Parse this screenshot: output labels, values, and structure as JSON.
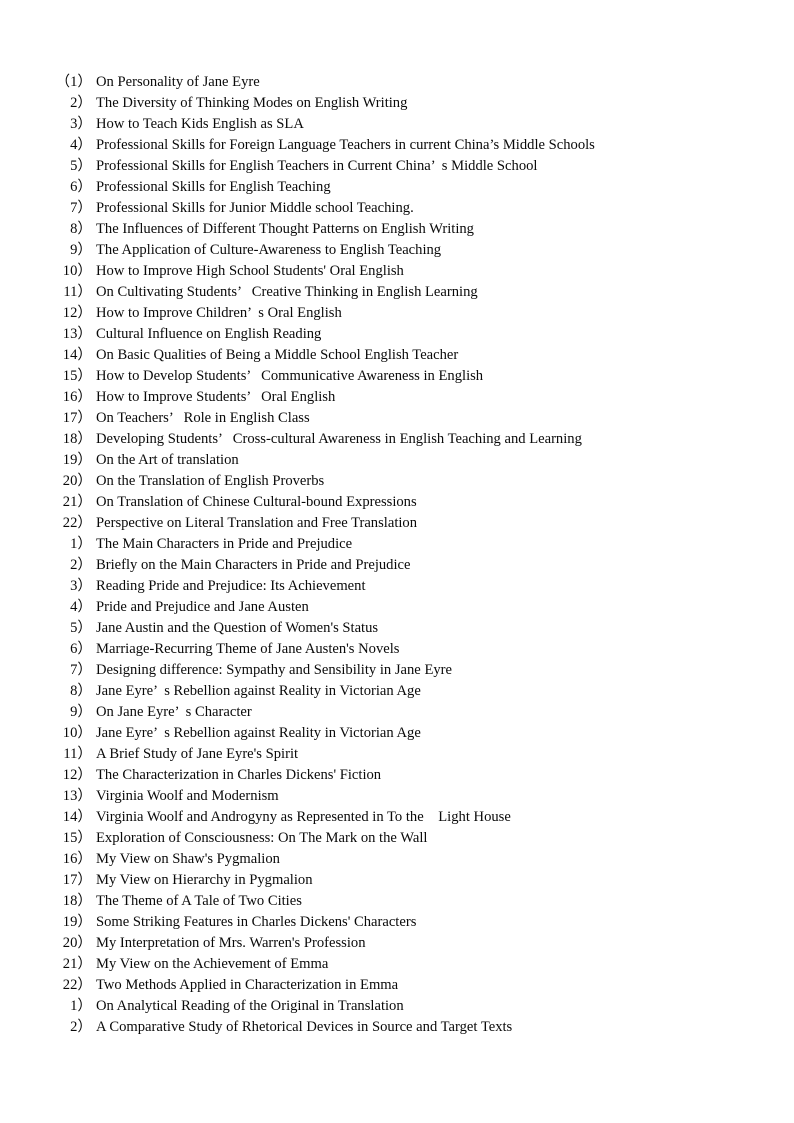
{
  "document": {
    "type": "thesis-topic-list",
    "page_background": "#ffffff",
    "text_color": "#0a0a0a",
    "groups": [
      {
        "group_index": 1,
        "items": [
          {
            "number": "（1）",
            "title": "On Personality of Jane Eyre"
          },
          {
            "number": "2）",
            "title": "The Diversity of Thinking Modes on English Writing"
          },
          {
            "number": "3）",
            "title": "How to Teach Kids English as SLA"
          },
          {
            "number": "4）",
            "title": "Professional Skills for Foreign Language Teachers in current China’s Middle Schools"
          },
          {
            "number": "5）",
            "title": "Professional Skills for English Teachers in Current China’  s Middle School"
          },
          {
            "number": "6）",
            "title": "Professional Skills for English Teaching"
          },
          {
            "number": "7）",
            "title": "Professional Skills for Junior Middle school Teaching."
          },
          {
            "number": "8）",
            "title": "The Influences of Different Thought Patterns on English Writing"
          },
          {
            "number": "9）",
            "title": "The Application of Culture-Awareness to English Teaching"
          },
          {
            "number": "10）",
            "title": "How to Improve High School Students' Oral English"
          },
          {
            "number": "11）",
            "title": "On Cultivating Students’   Creative Thinking in English Learning"
          },
          {
            "number": "12）",
            "title": "How to Improve Children’  s Oral English"
          },
          {
            "number": "13）",
            "title": "Cultural Influence on English Reading"
          },
          {
            "number": "14）",
            "title": "On Basic Qualities of Being a Middle School English Teacher"
          },
          {
            "number": "15）",
            "title": "How to Develop Students’   Communicative Awareness in English"
          },
          {
            "number": "16）",
            "title": "How to Improve Students’   Oral English"
          },
          {
            "number": "17）",
            "title": "On Teachers’   Role in English Class"
          },
          {
            "number": "18）",
            "title": "Developing Students’   Cross-cultural Awareness in English Teaching and Learning"
          },
          {
            "number": "19）",
            "title": "On the Art of translation"
          },
          {
            "number": "20）",
            "title": "On the Translation of English Proverbs"
          },
          {
            "number": "21）",
            "title": "On Translation of Chinese Cultural-bound Expressions"
          },
          {
            "number": "22）",
            "title": "Perspective on Literal Translation and Free Translation"
          }
        ]
      },
      {
        "group_index": 2,
        "items": [
          {
            "number": "1）",
            "title": "The Main Characters in Pride and Prejudice"
          },
          {
            "number": "2）",
            "title": "Briefly on the Main Characters in Pride and Prejudice"
          },
          {
            "number": "3）",
            "title": "Reading Pride and Prejudice: Its Achievement"
          },
          {
            "number": "4）",
            "title": "Pride and Prejudice and Jane Austen"
          },
          {
            "number": "5）",
            "title": "Jane Austin and the Question of Women's Status"
          },
          {
            "number": "6）",
            "title": "Marriage-Recurring Theme of Jane Austen's Novels"
          },
          {
            "number": "7）",
            "title": "Designing difference: Sympathy and Sensibility in Jane Eyre"
          },
          {
            "number": "8）",
            "title": "Jane Eyre’  s Rebellion against Reality in Victorian Age"
          },
          {
            "number": "9）",
            "title": "On Jane Eyre’  s Character"
          },
          {
            "number": "10）",
            "title": "Jane Eyre’  s Rebellion against Reality in Victorian Age"
          },
          {
            "number": "11）",
            "title": "A Brief Study of Jane Eyre's Spirit"
          },
          {
            "number": "12）",
            "title": "The Characterization in Charles Dickens' Fiction"
          },
          {
            "number": "13）",
            "title": "Virginia Woolf and Modernism"
          },
          {
            "number": "14）",
            "title": "Virginia Woolf and Androgyny as Represented in To the    Light House"
          },
          {
            "number": "15）",
            "title": "Exploration of Consciousness: On The Mark on the Wall"
          },
          {
            "number": "16）",
            "title": "My View on Shaw's Pygmalion"
          },
          {
            "number": "17）",
            "title": "My View on Hierarchy in Pygmalion"
          },
          {
            "number": "18）",
            "title": "The Theme of A Tale of Two Cities"
          },
          {
            "number": "19）",
            "title": "Some Striking Features in Charles Dickens' Characters"
          },
          {
            "number": "20）",
            "title": "My Interpretation of Mrs. Warren's Profession"
          },
          {
            "number": "21）",
            "title": "My View on the Achievement of Emma"
          },
          {
            "number": "22）",
            "title": "Two Methods Applied in Characterization in Emma"
          }
        ]
      },
      {
        "group_index": 3,
        "items": [
          {
            "number": "1）",
            "title": "On Analytical Reading of the Original in Translation"
          },
          {
            "number": "2）",
            "title": "A Comparative Study of Rhetorical Devices in Source and Target Texts"
          }
        ]
      }
    ]
  }
}
